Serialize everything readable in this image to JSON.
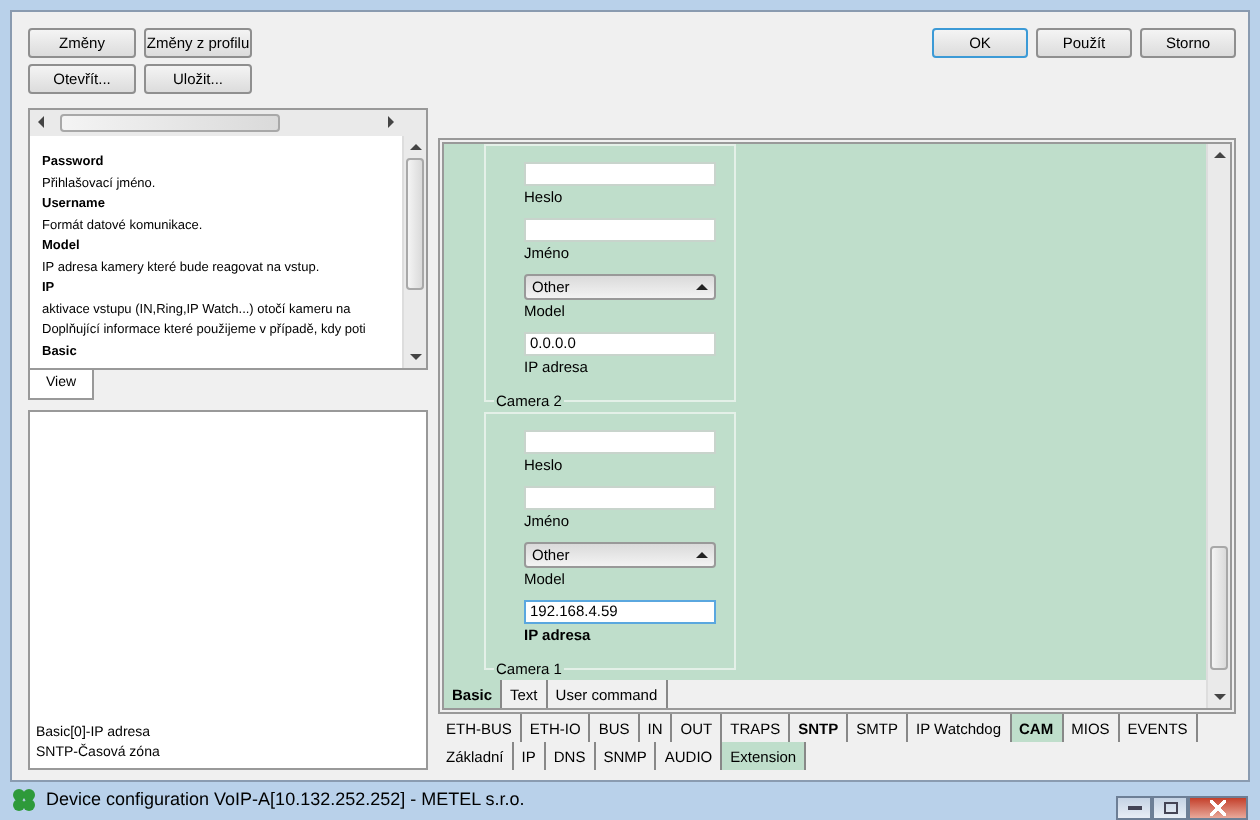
{
  "left_buttons": [
    [
      "Změny",
      "Změny z profilu"
    ],
    [
      "Otevřít...",
      "Uložit..."
    ]
  ],
  "dialog_buttons": [
    {
      "label": "OK",
      "default": true
    },
    {
      "label": "Použít",
      "default": false
    },
    {
      "label": "Storno",
      "default": false
    }
  ],
  "help": {
    "entries": [
      {
        "kind": "heading",
        "text": "Password"
      },
      {
        "kind": "text",
        "text": "Přihlašovací jméno."
      },
      {
        "kind": "heading",
        "text": "Username"
      },
      {
        "kind": "text",
        "text": "Formát datové komunikace."
      },
      {
        "kind": "heading",
        "text": "Model"
      },
      {
        "kind": "text",
        "text": "IP adresa kamery které bude reagovat na vstup."
      },
      {
        "kind": "heading",
        "text": "IP"
      },
      {
        "kind": "text",
        "text": "aktivace vstupu (IN,Ring,IP Watch...) otočí kameru na"
      },
      {
        "kind": "text",
        "text": "Doplňující informace které použijeme v případě, kdy poti"
      },
      {
        "kind": "heading",
        "text": "Basic"
      }
    ],
    "tab": "View"
  },
  "cameras": [
    {
      "fields": [
        {
          "kind": "text",
          "label": "Heslo"
        },
        {
          "kind": "text",
          "label": "Jméno"
        },
        {
          "kind": "select",
          "label": "Model",
          "value": "Other"
        },
        {
          "kind": "text",
          "label": "IP adresa",
          "value": "0.0.0.0",
          "modified": false,
          "focused": false
        }
      ],
      "title": "Camera 2"
    },
    {
      "fields": [
        {
          "kind": "text",
          "label": "Heslo"
        },
        {
          "kind": "text",
          "label": "Jméno"
        },
        {
          "kind": "select",
          "label": "Model",
          "value": "Other"
        },
        {
          "kind": "text",
          "label": "IP adresa",
          "value": "192.168.4.59",
          "modified": true,
          "focused": true
        }
      ],
      "title": "Camera 1"
    }
  ],
  "section_tabs": [
    {
      "label": "Basic",
      "selected": true
    },
    {
      "label": "Text",
      "selected": false
    },
    {
      "label": "User command",
      "selected": false
    }
  ],
  "sub_tabs": [
    {
      "label": "ETH-BUS",
      "selected": false,
      "modified": false
    },
    {
      "label": "ETH-IO",
      "selected": false,
      "modified": false
    },
    {
      "label": "BUS",
      "selected": false,
      "modified": false
    },
    {
      "label": "IN",
      "selected": false,
      "modified": false
    },
    {
      "label": "OUT",
      "selected": false,
      "modified": false
    },
    {
      "label": "TRAPS",
      "selected": false,
      "modified": false
    },
    {
      "label": "SNTP",
      "selected": false,
      "modified": true
    },
    {
      "label": "SMTP",
      "selected": false,
      "modified": false
    },
    {
      "label": "IP Watchdog",
      "selected": false,
      "modified": false
    },
    {
      "label": "CAM",
      "selected": true,
      "modified": true
    },
    {
      "label": "MIOS",
      "selected": false,
      "modified": false
    },
    {
      "label": "EVENTS",
      "selected": false,
      "modified": false
    }
  ],
  "changes_list": [
    "Basic[0]-IP adresa",
    "SNTP-Časová zóna"
  ],
  "main_tabs": [
    {
      "label": "Základní",
      "selected": false
    },
    {
      "label": "IP",
      "selected": false
    },
    {
      "label": "DNS",
      "selected": false
    },
    {
      "label": "SNMP",
      "selected": false
    },
    {
      "label": "AUDIO",
      "selected": false
    },
    {
      "label": "Extension",
      "selected": true
    }
  ],
  "window": {
    "title": "Device configuration VoIP-A[10.132.252.252] - METEL s.r.o."
  }
}
